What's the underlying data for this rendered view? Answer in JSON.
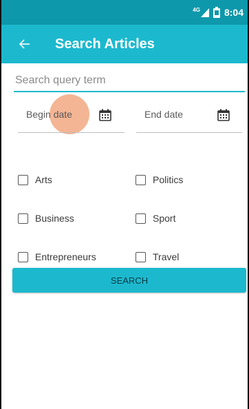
{
  "status_bar": {
    "network": "4G",
    "time": "8:04",
    "icons": [
      "signal-icon",
      "battery-icon"
    ]
  },
  "app_bar": {
    "back_icon": "arrow-left-icon",
    "title": "Search Articles"
  },
  "search": {
    "placeholder": "Search query term",
    "value": ""
  },
  "dates": {
    "begin_label": "Begin date",
    "end_label": "End date",
    "icon": "calendar-icon"
  },
  "categories": [
    {
      "label": "Arts",
      "checked": false
    },
    {
      "label": "Politics",
      "checked": false
    },
    {
      "label": "Business",
      "checked": false
    },
    {
      "label": "Sport",
      "checked": false
    },
    {
      "label": "Entrepreneurs",
      "checked": false
    },
    {
      "label": "Travel",
      "checked": false
    }
  ],
  "search_button": {
    "label": "SEARCH"
  },
  "colors": {
    "status_bar": "#0e98ab",
    "app_bar": "#1cb9ce",
    "accent": "#1cb9ce",
    "touch_ripple": "#eb783c"
  }
}
